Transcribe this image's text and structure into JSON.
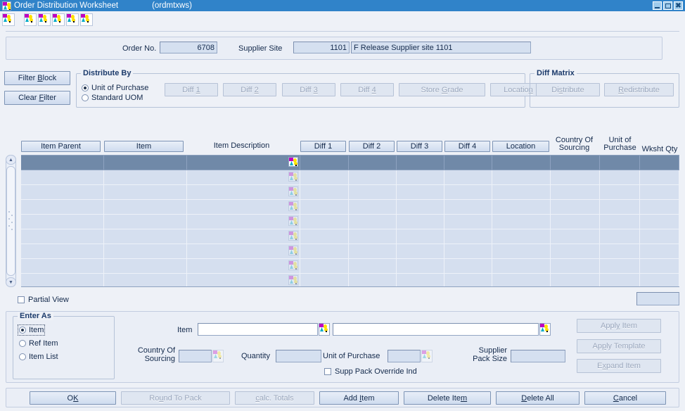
{
  "window": {
    "title": "Order Distribution Worksheet",
    "code": "(ordmtxws)",
    "icon": "form-window-icon",
    "controls": {
      "minimize": "_",
      "maximize": "☐",
      "close": "✖"
    }
  },
  "toolbar": {
    "buttons": [
      {
        "name": "toolbar-button-1",
        "icon": "lov-icon"
      },
      {
        "name": "toolbar-button-2",
        "icon": "lov-icon"
      },
      {
        "name": "toolbar-button-3",
        "icon": "lov-icon"
      },
      {
        "name": "toolbar-button-4",
        "icon": "lov-icon"
      },
      {
        "name": "toolbar-button-5",
        "icon": "lov-icon"
      },
      {
        "name": "toolbar-button-6",
        "icon": "lov-icon"
      }
    ]
  },
  "header": {
    "order_no_label": "Order No.",
    "order_no_value": "6708",
    "supplier_site_label": "Supplier Site",
    "supplier_site_value": "1101",
    "supplier_site_desc": "F Release Supplier site 1101"
  },
  "filter": {
    "filter_block_label": "Filter Block",
    "filter_block_mnemonic": "B",
    "clear_filter_label": "Clear Filter",
    "clear_filter_mnemonic": "F"
  },
  "distribute_by": {
    "title": "Distribute By",
    "options": [
      {
        "label": "Unit of Purchase",
        "selected": true
      },
      {
        "label": "Standard UOM",
        "selected": false
      }
    ],
    "buttons": [
      {
        "label": "Diff 1",
        "mnemonic": "1",
        "enabled": false
      },
      {
        "label": "Diff 2",
        "mnemonic": "2",
        "enabled": false
      },
      {
        "label": "Diff 3",
        "mnemonic": "3",
        "enabled": false
      },
      {
        "label": "Diff 4",
        "mnemonic": "4",
        "enabled": false
      },
      {
        "label": "Store Grade",
        "mnemonic": "G",
        "enabled": false
      },
      {
        "label": "Location",
        "mnemonic": "n",
        "enabled": false
      }
    ]
  },
  "diff_matrix": {
    "title": "Diff Matrix",
    "buttons": [
      {
        "label": "Distribute",
        "mnemonic": "s",
        "enabled": false
      },
      {
        "label": "Redistribute",
        "mnemonic": "R",
        "enabled": false
      }
    ]
  },
  "table": {
    "headers": [
      {
        "label": "Item Parent",
        "type": "button"
      },
      {
        "label": "Item",
        "type": "button"
      },
      {
        "label": "Item Description",
        "type": "text"
      },
      {
        "label": "Diff 1",
        "type": "button"
      },
      {
        "label": "Diff 2",
        "type": "button"
      },
      {
        "label": "Diff 3",
        "type": "button"
      },
      {
        "label": "Diff 4",
        "type": "button"
      },
      {
        "label": "Location",
        "type": "button"
      },
      {
        "label": "Country Of Sourcing",
        "type": "text"
      },
      {
        "label": "Unit of Purchase",
        "type": "text"
      },
      {
        "label": "Wksht Qty",
        "type": "text"
      }
    ],
    "row_count": 9,
    "selected_row": 0,
    "rows": [
      {
        "item_parent": "",
        "item": "",
        "item_description": "",
        "diff1": "",
        "diff2": "",
        "diff3": "",
        "diff4": "",
        "location": "",
        "country_of_sourcing": "",
        "unit_of_purchase": "",
        "wksht_qty": ""
      },
      {
        "item_parent": "",
        "item": "",
        "item_description": "",
        "diff1": "",
        "diff2": "",
        "diff3": "",
        "diff4": "",
        "location": "",
        "country_of_sourcing": "",
        "unit_of_purchase": "",
        "wksht_qty": ""
      },
      {
        "item_parent": "",
        "item": "",
        "item_description": "",
        "diff1": "",
        "diff2": "",
        "diff3": "",
        "diff4": "",
        "location": "",
        "country_of_sourcing": "",
        "unit_of_purchase": "",
        "wksht_qty": ""
      },
      {
        "item_parent": "",
        "item": "",
        "item_description": "",
        "diff1": "",
        "diff2": "",
        "diff3": "",
        "diff4": "",
        "location": "",
        "country_of_sourcing": "",
        "unit_of_purchase": "",
        "wksht_qty": ""
      },
      {
        "item_parent": "",
        "item": "",
        "item_description": "",
        "diff1": "",
        "diff2": "",
        "diff3": "",
        "diff4": "",
        "location": "",
        "country_of_sourcing": "",
        "unit_of_purchase": "",
        "wksht_qty": ""
      },
      {
        "item_parent": "",
        "item": "",
        "item_description": "",
        "diff1": "",
        "diff2": "",
        "diff3": "",
        "diff4": "",
        "location": "",
        "country_of_sourcing": "",
        "unit_of_purchase": "",
        "wksht_qty": ""
      },
      {
        "item_parent": "",
        "item": "",
        "item_description": "",
        "diff1": "",
        "diff2": "",
        "diff3": "",
        "diff4": "",
        "location": "",
        "country_of_sourcing": "",
        "unit_of_purchase": "",
        "wksht_qty": ""
      },
      {
        "item_parent": "",
        "item": "",
        "item_description": "",
        "diff1": "",
        "diff2": "",
        "diff3": "",
        "diff4": "",
        "location": "",
        "country_of_sourcing": "",
        "unit_of_purchase": "",
        "wksht_qty": ""
      },
      {
        "item_parent": "",
        "item": "",
        "item_description": "",
        "diff1": "",
        "diff2": "",
        "diff3": "",
        "diff4": "",
        "location": "",
        "country_of_sourcing": "",
        "unit_of_purchase": "",
        "wksht_qty": ""
      }
    ],
    "partial_view_label": "Partial View",
    "partial_view_checked": false,
    "total_value": ""
  },
  "enter_as": {
    "title": "Enter As",
    "options": [
      {
        "label": "Item",
        "selected": true,
        "focused": true
      },
      {
        "label": "Ref Item",
        "selected": false,
        "focused": false
      },
      {
        "label": "Item List",
        "selected": false,
        "focused": false
      }
    ]
  },
  "entry": {
    "item_label": "Item",
    "item_value": "",
    "item_desc_value": "",
    "country_of_sourcing_label": "Country Of Sourcing",
    "country_of_sourcing_value": "",
    "quantity_label": "Quantity",
    "quantity_value": "",
    "unit_of_purchase_label": "Unit of Purchase",
    "unit_of_purchase_value": "",
    "supplier_pack_size_label": "Supplier Pack Size",
    "supplier_pack_size_value": "",
    "supp_pack_override_label": "Supp Pack Override Ind",
    "supp_pack_override_checked": false,
    "actions": [
      {
        "label": "Apply Item",
        "mnemonic": "y",
        "enabled": false
      },
      {
        "label": "Apply Template",
        "mnemonic": "p",
        "enabled": false
      },
      {
        "label": "Expand Item",
        "mnemonic": "x",
        "enabled": false
      }
    ]
  },
  "footer": {
    "buttons": [
      {
        "label": "OK",
        "mnemonic": "K",
        "enabled": true
      },
      {
        "label": "Round To Pack",
        "mnemonic": "u",
        "enabled": false
      },
      {
        "label": "Calc. Totals",
        "mnemonic": "c",
        "enabled": false
      },
      {
        "label": "Add Item",
        "mnemonic": "I",
        "enabled": true
      },
      {
        "label": "Delete Item",
        "mnemonic": "m",
        "enabled": true
      },
      {
        "label": "Delete All",
        "mnemonic": "D",
        "enabled": true
      },
      {
        "label": "Cancel",
        "mnemonic": "C",
        "enabled": true
      }
    ]
  },
  "colors": {
    "titlebar": "#3083c9",
    "background": "#eef1f7",
    "field_disabled": "#d5e0f0",
    "row_selected": "#7089a8",
    "row_normal": "#d5dfef",
    "label_text": "#13294b",
    "group_title": "#1b3a6b"
  }
}
